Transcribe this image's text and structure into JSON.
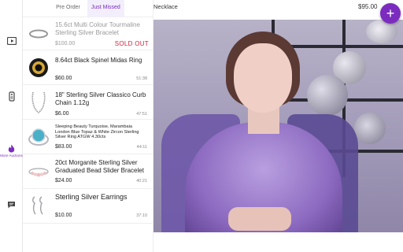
{
  "header": {
    "now_playing_title": "Necklace",
    "now_playing_price": "$95.00",
    "add_label": "+"
  },
  "rail": {
    "more_auctions_label": "More Auctions"
  },
  "tabs": [
    {
      "label": "Pre Order"
    },
    {
      "label": "Just Missed"
    }
  ],
  "items": [
    {
      "name": "15.6ct Multi Colour Tourmaline Sterling Silver Bracelet",
      "price": "$100.00",
      "status": "SOLD OUT",
      "icon": "bracelet-icon"
    },
    {
      "name": "8.64ct Black Spinel Midas Ring",
      "price": "$60.00",
      "time": "51:38",
      "icon": "ring-icon"
    },
    {
      "name": "18\" Sterling Silver Classico Curb Chain 1.12g",
      "price": "$6.00",
      "time": "47:51",
      "icon": "chain-icon"
    },
    {
      "name": "Sleeping Beauty Turquoise, Marambaia London Blue Topaz & White Zircon Sterling Silver Ring ATGW 4.30cts",
      "price": "$83.00",
      "time": "44:11",
      "icon": "turquoise-ring-icon"
    },
    {
      "name": "20ct Morganite Sterling Silver Graduated Bead Slider Bracelet",
      "price": "$24.00",
      "time": "40:21",
      "icon": "bead-bracelet-icon"
    },
    {
      "name": "Sterling Silver Earrings",
      "price": "$10.00",
      "time": "37:10",
      "icon": "earrings-icon"
    }
  ],
  "colors": {
    "accent": "#7b2cbf",
    "sold_out": "#d21f3c"
  }
}
